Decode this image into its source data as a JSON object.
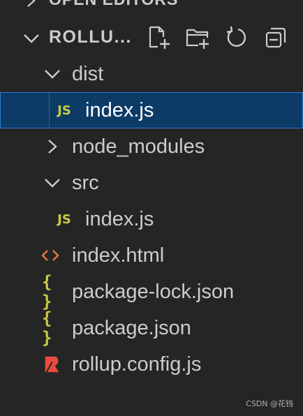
{
  "explorer": {
    "open_editors_label": "OPEN EDITORS",
    "project_label": "ROLLU...",
    "actions": [
      {
        "name": "new-file",
        "icon": "new-file-icon"
      },
      {
        "name": "new-folder",
        "icon": "new-folder-icon"
      },
      {
        "name": "refresh",
        "icon": "refresh-icon"
      },
      {
        "name": "collapse-all",
        "icon": "collapse-all-icon"
      }
    ],
    "tree": {
      "dist": {
        "label": "dist",
        "expanded": true
      },
      "dist_index": {
        "label": "index.js",
        "icon_text": "JS",
        "selected": true
      },
      "node_modules": {
        "label": "node_modules",
        "expanded": false
      },
      "src": {
        "label": "src",
        "expanded": true
      },
      "src_index": {
        "label": "index.js",
        "icon_text": "JS"
      },
      "index_html": {
        "label": "index.html",
        "icon_text": "<>"
      },
      "package_lock": {
        "label": "package-lock.json",
        "icon_text": "{ }"
      },
      "package_json": {
        "label": "package.json",
        "icon_text": "{ }"
      },
      "rollup_config": {
        "label": "rollup.config.js"
      }
    },
    "colors": {
      "background": "#252526",
      "selected_bg": "#0c3b66",
      "selected_border": "#2f7ad1",
      "js_yellow": "#cbcb41",
      "html_orange": "#e37933",
      "rollup_red": "#ec4a3f",
      "text": "#cccccc"
    }
  },
  "watermark": "CSDN @花铛"
}
